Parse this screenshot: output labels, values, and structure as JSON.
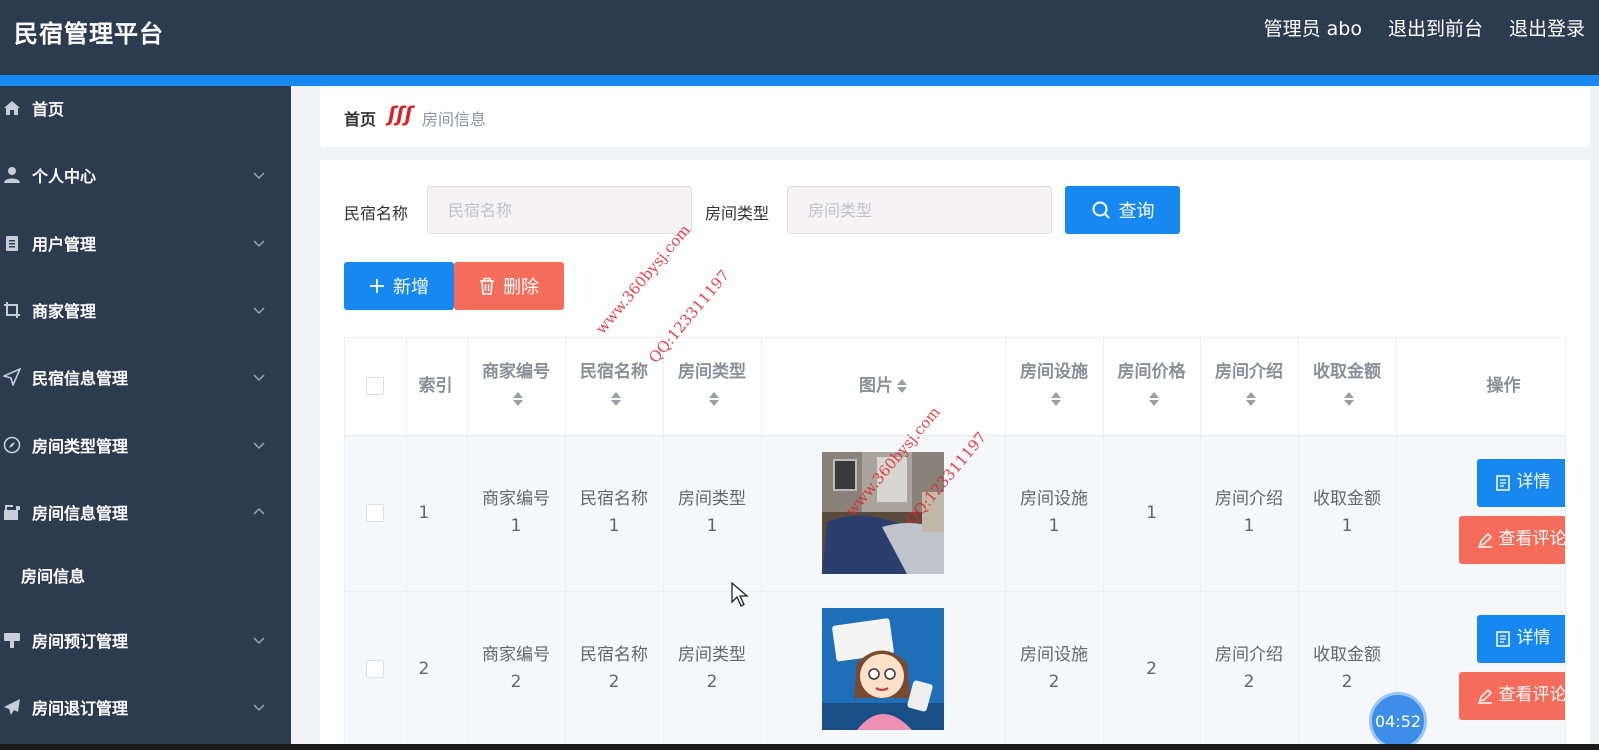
{
  "header": {
    "title": "民宿管理平台",
    "admin_label": "管理员 abo",
    "to_frontend": "退出到前台",
    "logout": "退出登录"
  },
  "sidebar": {
    "items": [
      {
        "label": "首页",
        "icon": "home-icon"
      },
      {
        "label": "个人中心",
        "icon": "user-icon"
      },
      {
        "label": "用户管理",
        "icon": "clipboard-icon"
      },
      {
        "label": "商家管理",
        "icon": "crop-icon"
      },
      {
        "label": "民宿信息管理",
        "icon": "send-icon"
      },
      {
        "label": "房间类型管理",
        "icon": "compass-icon"
      },
      {
        "label": "房间信息管理",
        "icon": "camera-icon"
      },
      {
        "label": "房间预订管理",
        "icon": "stamp-icon"
      },
      {
        "label": "房间退订管理",
        "icon": "plane-icon"
      }
    ],
    "sub_item": "房间信息"
  },
  "breadcrumb": {
    "home": "首页",
    "separator": "ʃʃʃ",
    "current": "房间信息"
  },
  "search": {
    "name_label": "民宿名称",
    "name_placeholder": "民宿名称",
    "type_label": "房间类型",
    "type_placeholder": "房间类型",
    "query_button": "查询"
  },
  "actions": {
    "add": "新增",
    "delete": "删除"
  },
  "table": {
    "columns": [
      "索引",
      "商家编号",
      "民宿名称",
      "房间类型",
      "图片",
      "房间设施",
      "房间价格",
      "房间介绍",
      "收取金额",
      "操作"
    ],
    "rows": [
      {
        "index": "1",
        "merchant_no": "商家编号1",
        "homestay_name": "民宿名称1",
        "room_type": "房间类型1",
        "facilities": "房间设施1",
        "price": "1",
        "intro": "房间介绍1",
        "amount": "收取金额1"
      },
      {
        "index": "2",
        "merchant_no": "商家编号2",
        "homestay_name": "民宿名称2",
        "room_type": "房间类型2",
        "facilities": "房间设施2",
        "price": "2",
        "intro": "房间介绍2",
        "amount": "收取金额2"
      }
    ],
    "detail_button": "详情",
    "review_button": "查看评论"
  },
  "watermark": {
    "site": "www.360bysj.com",
    "qq": "QQ:123311197"
  },
  "timer": "04:52",
  "colors": {
    "header_bg": "#2c3b50",
    "accent_blue": "#1788f0",
    "danger_red": "#f56c5b"
  }
}
